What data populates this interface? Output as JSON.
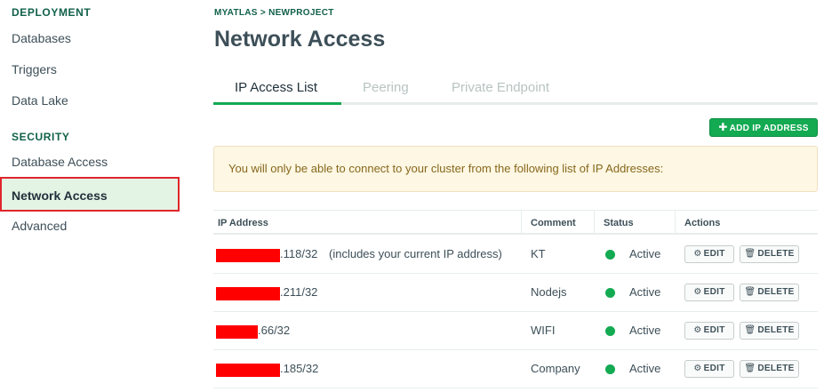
{
  "sidebar": {
    "sections": [
      {
        "title": "DEPLOYMENT",
        "items": [
          "Databases",
          "Triggers",
          "Data Lake"
        ]
      },
      {
        "title": "SECURITY",
        "items": [
          "Database Access",
          "Network Access",
          "Advanced"
        ]
      }
    ],
    "active_item": "Network Access"
  },
  "breadcrumb": "MYATLAS > NEWPROJECT",
  "page_title": "Network Access",
  "tabs": [
    {
      "label": "IP Access List",
      "active": true
    },
    {
      "label": "Peering",
      "active": false
    },
    {
      "label": "Private Endpoint",
      "active": false
    }
  ],
  "add_button": {
    "icon": "plus-icon",
    "label": "ADD IP ADDRESS"
  },
  "banner": "You will only be able to connect to your cluster from the following list of IP Addresses:",
  "table": {
    "headers": [
      "IP Address",
      "Comment",
      "Status",
      "Actions"
    ],
    "rows": [
      {
        "ip": ".118/32",
        "ip_note": "(includes your current IP address)",
        "comment": "KT",
        "status": "Active"
      },
      {
        "ip": ".211/32",
        "ip_note": "",
        "comment": "Nodejs",
        "status": "Active"
      },
      {
        "ip": ".66/32",
        "ip_note": "",
        "comment": "WIFI",
        "status": "Active"
      },
      {
        "ip": ".185/32",
        "ip_note": "",
        "comment": "Company",
        "status": "Active"
      }
    ],
    "edit_label": "EDIT",
    "delete_label": "DELETE",
    "edit_icon": "gear-icon",
    "delete_icon": "trash-icon"
  },
  "colors": {
    "accent": "#13aa52",
    "highlight_border": "#e0262c",
    "redaction": "#ff0000",
    "banner_bg": "#fef7e3"
  }
}
